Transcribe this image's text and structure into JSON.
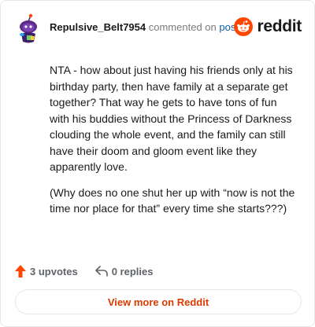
{
  "header": {
    "username": "Repulsive_Belt7954",
    "commented_text": "commented on",
    "post_link": "post",
    "brand": "reddit",
    "icons": {
      "avatar": "snoo-avatar-icon",
      "logo": "reddit-logo-icon"
    },
    "colors": {
      "brand": "#ff4500",
      "link": "#0b5fb0"
    }
  },
  "comment": {
    "paragraphs": [
      "NTA - how about just having his friends only at his birthday party, then have family at a separate get together? That way he gets to have tons of fun with his buddies without the Princess of Darkness clouding the whole event, and the family can still have their doom and gloom event like they apparently love.",
      "(Why does no one shut her up with “now is not the time nor place for that” every time she starts???)"
    ]
  },
  "actions": {
    "upvotes": "3 upvotes",
    "replies": "0 replies",
    "icons": {
      "upvote": "upvote-arrow-icon",
      "reply": "reply-arrow-icon"
    },
    "colors": {
      "upvote": "#ff4500"
    }
  },
  "footer": {
    "view_more_label": "View more on Reddit",
    "color": "#d93a00"
  }
}
